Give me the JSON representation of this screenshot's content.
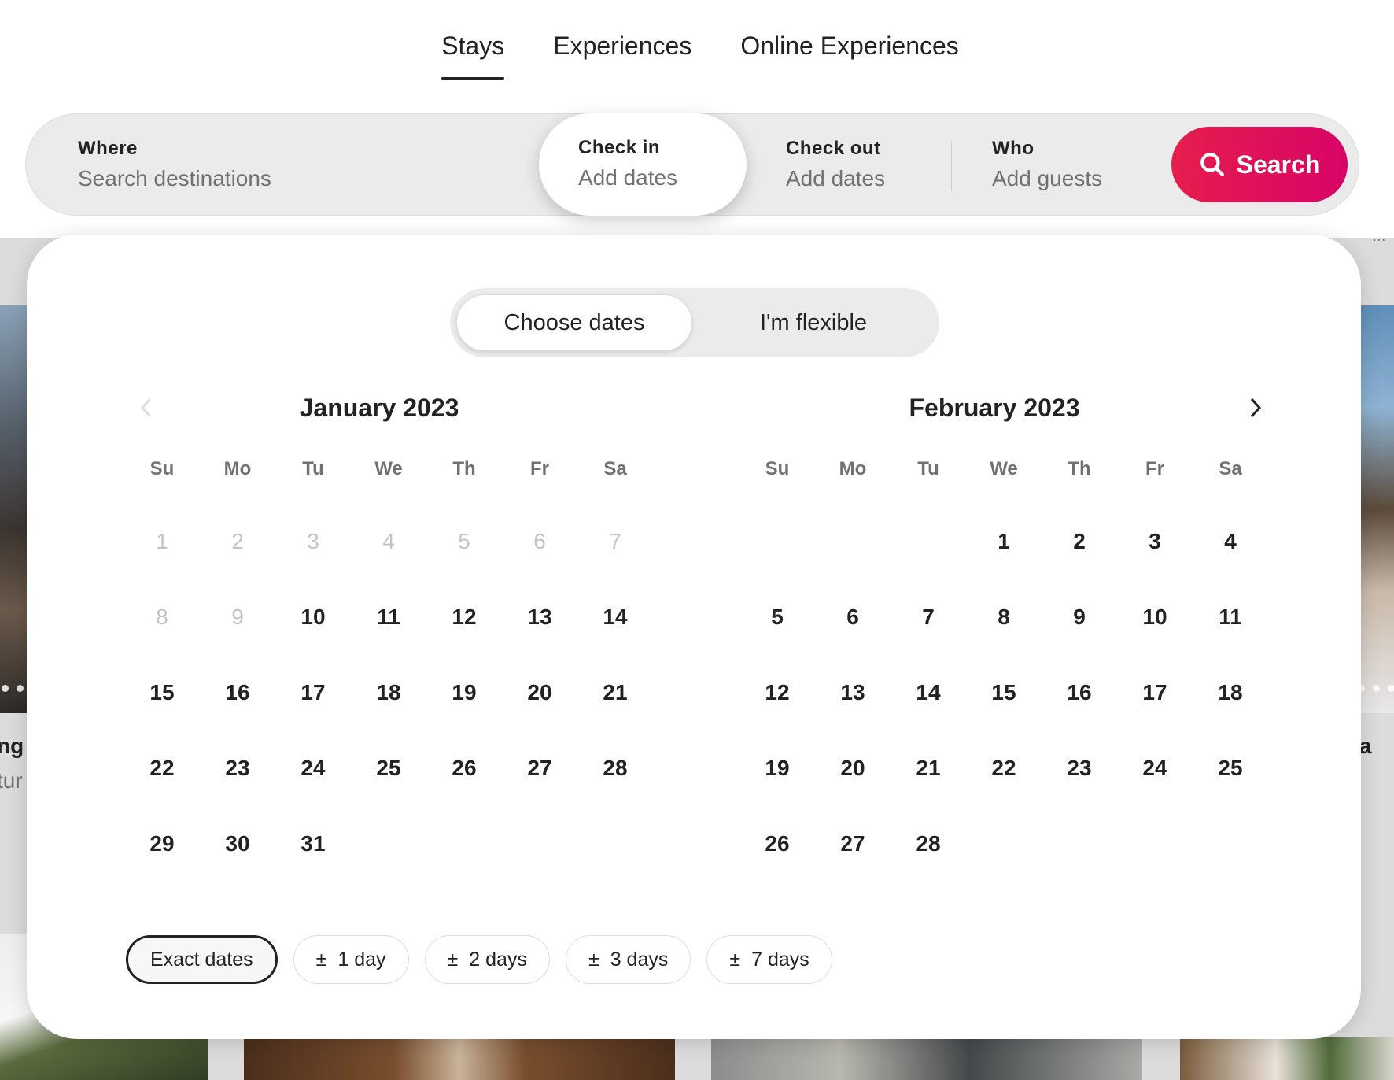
{
  "tabs": [
    {
      "label": "Stays",
      "active": true
    },
    {
      "label": "Experiences",
      "active": false
    },
    {
      "label": "Online Experiences",
      "active": false
    }
  ],
  "search": {
    "where": {
      "label": "Where",
      "placeholder": "Search destinations"
    },
    "check_in": {
      "label": "Check in",
      "value": "Add dates"
    },
    "check_out": {
      "label": "Check out",
      "value": "Add dates"
    },
    "who": {
      "label": "Who",
      "value": "Add guests"
    },
    "button_label": "Search",
    "button_icon": "search-icon",
    "accent_color": "#e61e4d"
  },
  "calendar": {
    "toggle": [
      {
        "label": "Choose dates",
        "active": true
      },
      {
        "label": "I'm flexible",
        "active": false
      }
    ],
    "prev_icon": "chevron-left-icon",
    "next_icon": "chevron-right-icon",
    "weekdays": [
      "Su",
      "Mo",
      "Tu",
      "We",
      "Th",
      "Fr",
      "Sa"
    ],
    "months": [
      {
        "title": "January 2023",
        "leading_blanks": 0,
        "days": 31,
        "past_until": 9
      },
      {
        "title": "February 2023",
        "leading_blanks": 3,
        "days": 28,
        "past_until": 0
      }
    ],
    "flex_chips": [
      {
        "label": "Exact dates",
        "prefix": "",
        "selected": true
      },
      {
        "label": "1 day",
        "prefix": "±",
        "selected": false
      },
      {
        "label": "2 days",
        "prefix": "±",
        "selected": false
      },
      {
        "label": "3 days",
        "prefix": "±",
        "selected": false
      },
      {
        "label": "7 days",
        "prefix": "±",
        "selected": false
      }
    ]
  },
  "background": {
    "left_title_fragment": "ng",
    "left_subtitle_fragment": "tur",
    "right_title_fragment": "a",
    "top_right_fragment": "…"
  }
}
